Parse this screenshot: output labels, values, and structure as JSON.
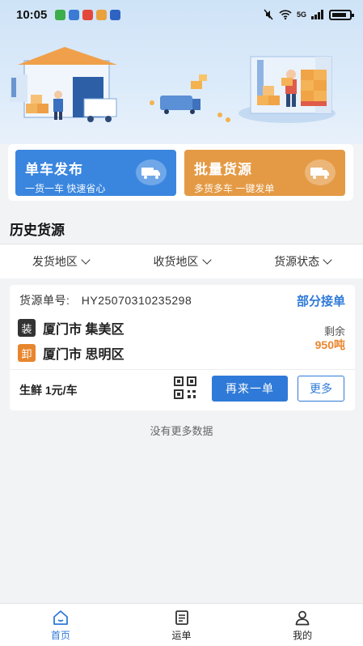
{
  "status_bar": {
    "time": "10:05",
    "signal_text": "5G"
  },
  "action_cards": [
    {
      "title": "单车发布",
      "subtitle": "一货一车 快速省心",
      "color": "#3a86df"
    },
    {
      "title": "批量货源",
      "subtitle": "多货多车 一键发单",
      "color": "#e49a45"
    }
  ],
  "section": {
    "title": "历史货源"
  },
  "filters": [
    {
      "label": "发货地区"
    },
    {
      "label": "收货地区"
    },
    {
      "label": "货源状态"
    }
  ],
  "order": {
    "number_label": "货源单号:",
    "number": "HY25070310235298",
    "status": "部分接单",
    "load_tag": "装",
    "load_address": "厦门市 集美区",
    "unload_tag": "卸",
    "unload_address": "厦门市 思明区",
    "remain_label": "剩余",
    "remain_value": "950吨",
    "cargo": "生鲜 1元/车",
    "again_button": "再来一单",
    "more_button": "更多"
  },
  "no_more_text": "没有更多数据",
  "bottom_nav": [
    {
      "label": "首页",
      "icon": "home-icon",
      "active": true
    },
    {
      "label": "运单",
      "icon": "waybill-icon",
      "active": false
    },
    {
      "label": "我的",
      "icon": "profile-icon",
      "active": false
    }
  ],
  "colors": {
    "primary": "#2f7ad8",
    "accent": "#e8862d"
  }
}
